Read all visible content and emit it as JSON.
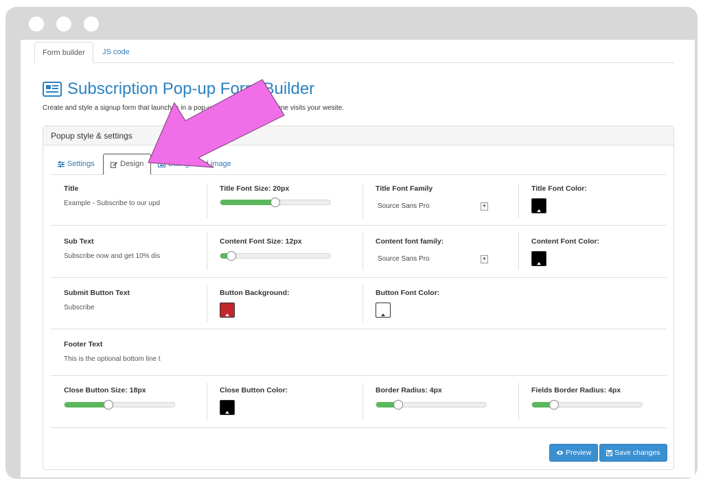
{
  "tabs": {
    "form_builder": "Form builder",
    "js_code": "JS code"
  },
  "page": {
    "title": "Subscription Pop-up Form Builder",
    "subtitle": "Create and style a signup form that launches in a pop-up window when someone visits your wesite."
  },
  "panel": {
    "heading": "Popup style & settings",
    "tabs": {
      "settings": "Settings",
      "design": "Design",
      "background": "Background image"
    }
  },
  "rows": [
    {
      "title_label": "Title",
      "title_value": "Example - Subscribe to our upd",
      "font_size_label": "Title Font Size: 20px",
      "font_size_level": 0.5,
      "font_family_label": "Title Font Family",
      "font_family_value": "Source Sans Pro",
      "font_color_label": "Title Font Color:",
      "font_color": "#000000"
    },
    {
      "title_label": "Sub Text",
      "title_value": "Subscribe now and get 10% dis",
      "font_size_label": "Content Font Size: 12px",
      "font_size_level": 0.1,
      "font_family_label": "Content font family:",
      "font_family_value": "Source Sans Pro",
      "font_color_label": "Content Font Color:",
      "font_color": "#000000"
    }
  ],
  "button_row": {
    "text_label": "Submit Button Text",
    "text_value": "Subscribe",
    "bg_label": "Button Background:",
    "bg_color": "#c0282d",
    "font_color_label": "Button Font Color:",
    "font_color": "#ffffff"
  },
  "footer_row": {
    "label": "Footer Text",
    "value": "This is the optional bottom line t"
  },
  "close_row": {
    "close_size_label": "Close Button Size: 18px",
    "close_size_level": 0.4,
    "close_color_label": "Close Button Color:",
    "close_color": "#000000",
    "border_radius_label": "Border Radius: 4px",
    "border_radius_level": 0.2,
    "fields_radius_label": "Fields Border Radius: 4px",
    "fields_radius_level": 0.2
  },
  "actions": {
    "preview": "Preview",
    "save": "Save changes"
  },
  "accent": "#2a82c0",
  "annotation_color": "#f06fe8"
}
